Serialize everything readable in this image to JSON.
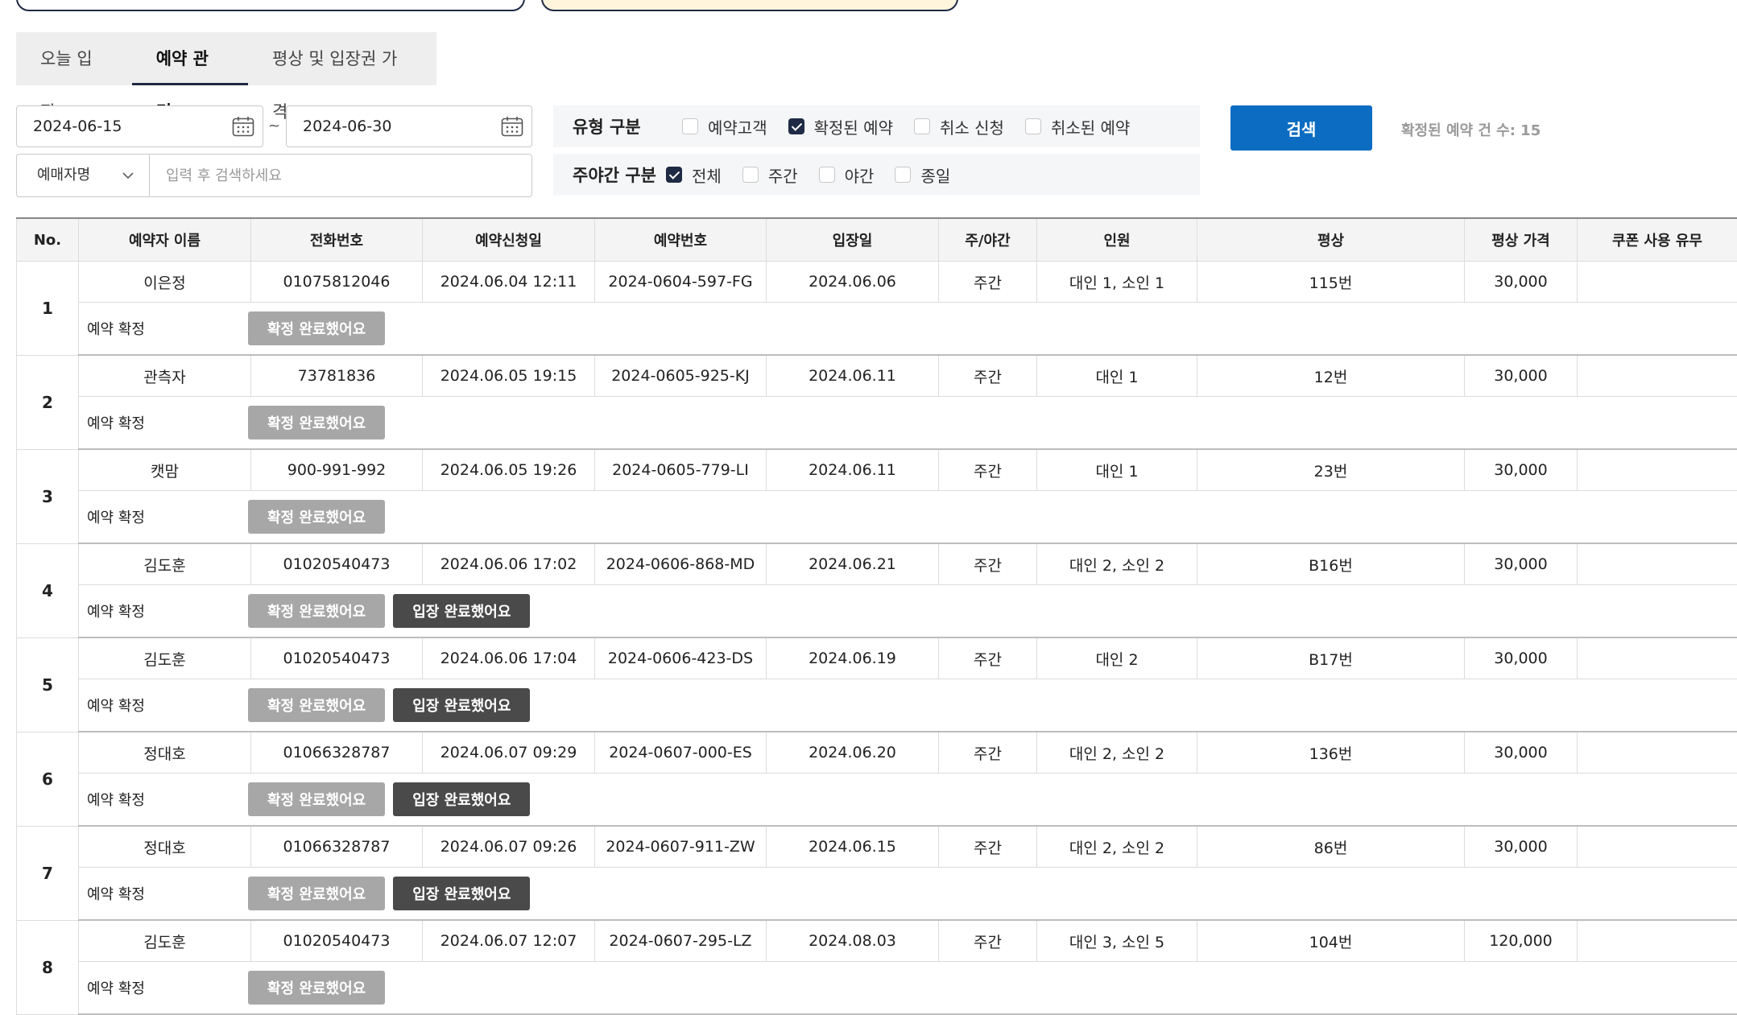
{
  "tabs": [
    {
      "label": "오늘 입장"
    },
    {
      "label": "예약 관리"
    },
    {
      "label": "평상 및 입장권 가격"
    }
  ],
  "active_tab": "예약 관리",
  "filters": {
    "date_from": "2024-06-15",
    "date_to": "2024-06-30",
    "date_separator": "~",
    "name_select": "예매자명",
    "search_placeholder": "입력 후 검색하세요",
    "type_label": "유형 구분",
    "type_options": [
      {
        "label": "예약고객",
        "checked": false
      },
      {
        "label": "확정된 예약",
        "checked": true
      },
      {
        "label": "취소 신청",
        "checked": false
      },
      {
        "label": "취소된 예약",
        "checked": false
      }
    ],
    "daynight_label": "주야간 구분",
    "daynight_options": [
      {
        "label": "전체",
        "checked": true
      },
      {
        "label": "주간",
        "checked": false
      },
      {
        "label": "야간",
        "checked": false
      },
      {
        "label": "종일",
        "checked": false
      }
    ]
  },
  "search_button": "검색",
  "count_text": "확정된 예약 건 수: 15",
  "table": {
    "headers": [
      "No.",
      "예약자 이름",
      "전화번호",
      "예약신청일",
      "예약번호",
      "입장일",
      "주/야간",
      "인원",
      "평상",
      "평상 가격",
      "쿠폰 사용 유무"
    ],
    "confirm_label": "예약 확정",
    "btn_confirmed": "확정 완료했어요",
    "btn_entered": "입장 완료했어요",
    "rows": [
      {
        "no": "1",
        "name": "이은정",
        "phone": "01075812046",
        "applied": "2024.06.04  12:11",
        "res_no": "2024-0604-597-FG",
        "entry": "2024.06.06",
        "daynight": "주간",
        "people": "대인 1, 소인 1",
        "bed": "115번",
        "price": "30,000",
        "coupon": "",
        "entered": false
      },
      {
        "no": "2",
        "name": "관측자",
        "phone": "73781836",
        "applied": "2024.06.05  19:15",
        "res_no": "2024-0605-925-KJ",
        "entry": "2024.06.11",
        "daynight": "주간",
        "people": "대인 1",
        "bed": "12번",
        "price": "30,000",
        "coupon": "",
        "entered": false
      },
      {
        "no": "3",
        "name": "캣맘",
        "phone": "900-991-992",
        "applied": "2024.06.05  19:26",
        "res_no": "2024-0605-779-LI",
        "entry": "2024.06.11",
        "daynight": "주간",
        "people": "대인 1",
        "bed": "23번",
        "price": "30,000",
        "coupon": "",
        "entered": false
      },
      {
        "no": "4",
        "name": "김도훈",
        "phone": "01020540473",
        "applied": "2024.06.06  17:02",
        "res_no": "2024-0606-868-MD",
        "entry": "2024.06.21",
        "daynight": "주간",
        "people": "대인 2, 소인 2",
        "bed": "B16번",
        "price": "30,000",
        "coupon": "",
        "entered": true
      },
      {
        "no": "5",
        "name": "김도훈",
        "phone": "01020540473",
        "applied": "2024.06.06  17:04",
        "res_no": "2024-0606-423-DS",
        "entry": "2024.06.19",
        "daynight": "주간",
        "people": "대인 2",
        "bed": "B17번",
        "price": "30,000",
        "coupon": "",
        "entered": true
      },
      {
        "no": "6",
        "name": "정대호",
        "phone": "01066328787",
        "applied": "2024.06.07  09:29",
        "res_no": "2024-0607-000-ES",
        "entry": "2024.06.20",
        "daynight": "주간",
        "people": "대인 2, 소인 2",
        "bed": "136번",
        "price": "30,000",
        "coupon": "",
        "entered": true
      },
      {
        "no": "7",
        "name": "정대호",
        "phone": "01066328787",
        "applied": "2024.06.07  09:26",
        "res_no": "2024-0607-911-ZW",
        "entry": "2024.06.15",
        "daynight": "주간",
        "people": "대인 2, 소인 2",
        "bed": "86번",
        "price": "30,000",
        "coupon": "",
        "entered": true
      },
      {
        "no": "8",
        "name": "김도훈",
        "phone": "01020540473",
        "applied": "2024.06.07  12:07",
        "res_no": "2024-0607-295-LZ",
        "entry": "2024.08.03",
        "daynight": "주간",
        "people": "대인 3, 소인 5",
        "bed": "104번",
        "price": "120,000",
        "coupon": "",
        "entered": false
      }
    ]
  },
  "colors": {
    "accent": "#0b6cc2",
    "dark": "#1f2a44",
    "btn_confirmed": "#a7a7a7",
    "btn_entered": "#4a4a4a"
  }
}
